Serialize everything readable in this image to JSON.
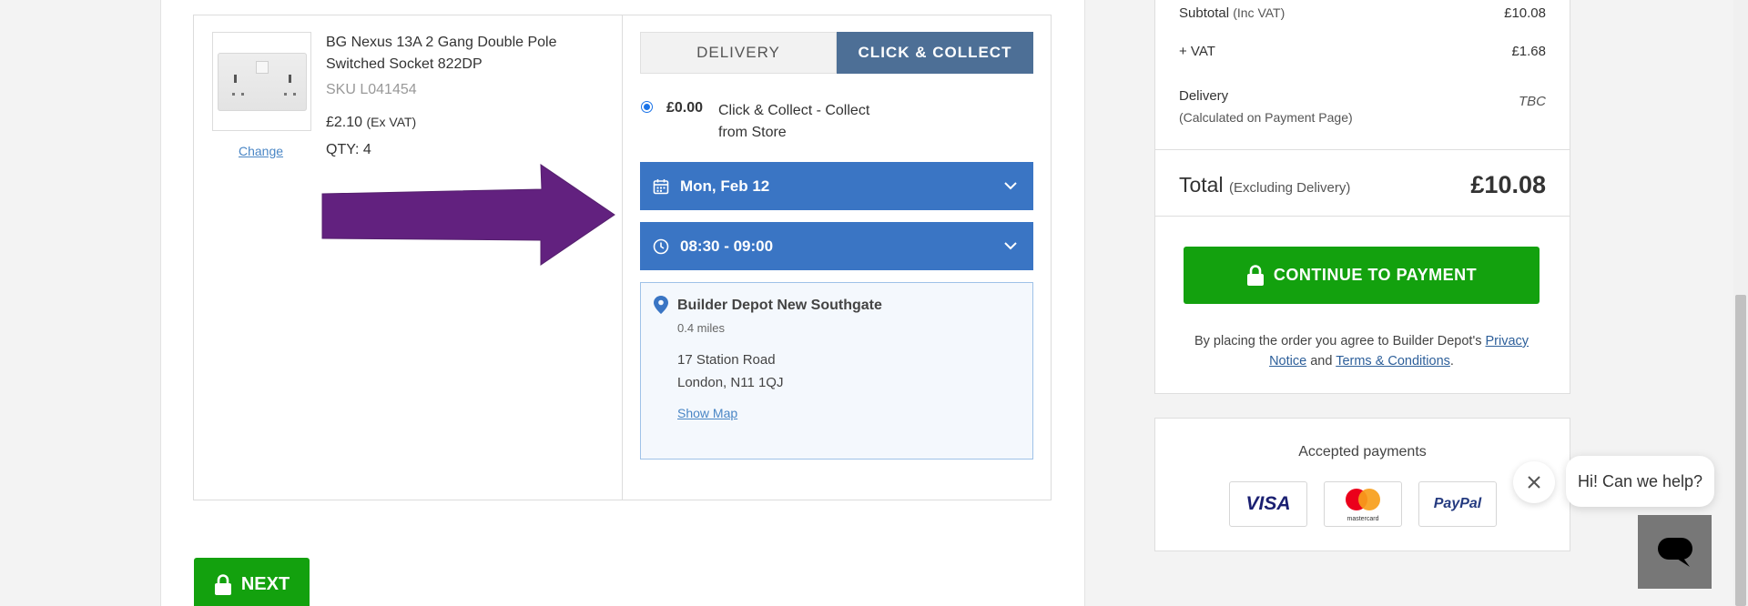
{
  "product": {
    "name": "BG Nexus 13A 2 Gang Double Pole Switched Socket 822DP",
    "sku": "SKU L041454",
    "price": "£2.10",
    "price_note": "(Ex VAT)",
    "qty": "QTY: 4",
    "change_label": "Change"
  },
  "tabs": {
    "delivery": "DELIVERY",
    "collect": "CLICK & COLLECT",
    "active": "CLICK & COLLECT"
  },
  "collect_option": {
    "price": "£0.00",
    "label": "Click & Collect - Collect from Store"
  },
  "date_select": {
    "value": "Mon, Feb 12"
  },
  "time_select": {
    "value": "08:30 - 09:00"
  },
  "store": {
    "name": "Builder Depot New Southgate",
    "distance": "0.4 miles",
    "address_line1": "17 Station Road",
    "address_line2": "London, N11 1QJ",
    "map_link": "Show Map"
  },
  "next_button": "NEXT",
  "summary": {
    "subtotal_label": "Subtotal",
    "subtotal_note": "(Inc VAT)",
    "subtotal_value": "£10.08",
    "vat_label": "+ VAT",
    "vat_value": "£1.68",
    "delivery_label": "Delivery",
    "delivery_note": "(Calculated on Payment Page)",
    "delivery_value": "TBC",
    "total_label": "Total",
    "total_note": "(Excluding Delivery)",
    "total_value": "£10.08",
    "pay_button": "CONTINUE TO PAYMENT",
    "terms_prefix": "By placing the order you agree to Builder Depot's",
    "privacy_link": "Privacy Notice",
    "terms_and": "and",
    "terms_link": "Terms & Conditions",
    "terms_suffix": "."
  },
  "payments": {
    "title": "Accepted payments",
    "methods": [
      "VISA",
      "mastercard",
      "PayPal"
    ]
  },
  "chat": {
    "bubble": "Hi! Can we help?"
  },
  "colors": {
    "tab_active": "#4d6f96",
    "dropdown": "#3a75c4",
    "green_button": "#13a10e",
    "arrow": "#62217f"
  }
}
